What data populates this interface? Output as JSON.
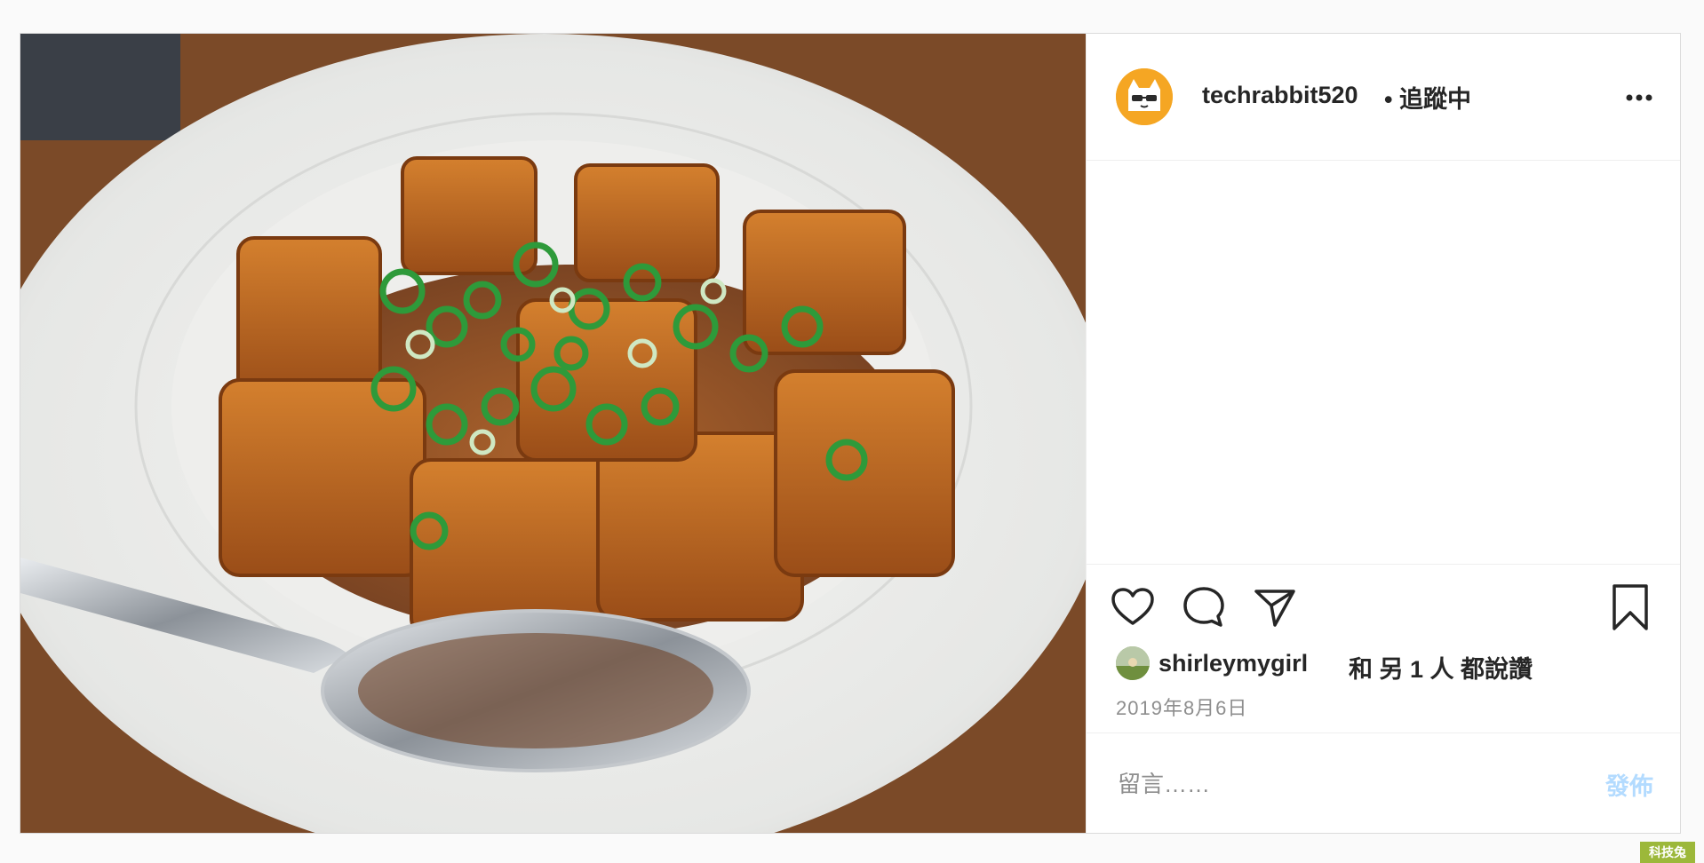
{
  "post": {
    "image_alt": "Fried tofu with scallions in a white plate",
    "username": "techrabbit520",
    "following_label": "• 追蹤中",
    "likes": {
      "liker_username": "shirleymygirl",
      "rest_text": "和 另 1 人 都說讚"
    },
    "date": "2019年8月6日",
    "comment": {
      "placeholder": "留言……",
      "post_label": "發佈"
    },
    "icons": [
      "heart-icon",
      "comment-icon",
      "share-icon",
      "bookmark-icon",
      "more-options-icon"
    ]
  },
  "watermark": "科技兔",
  "colors": {
    "text": "#262626",
    "secondary": "#8e8e8e",
    "post_button_disabled": "#b3dbff",
    "avatar_bg": "#f5a623",
    "watermark_bg": "#9cb83a"
  }
}
